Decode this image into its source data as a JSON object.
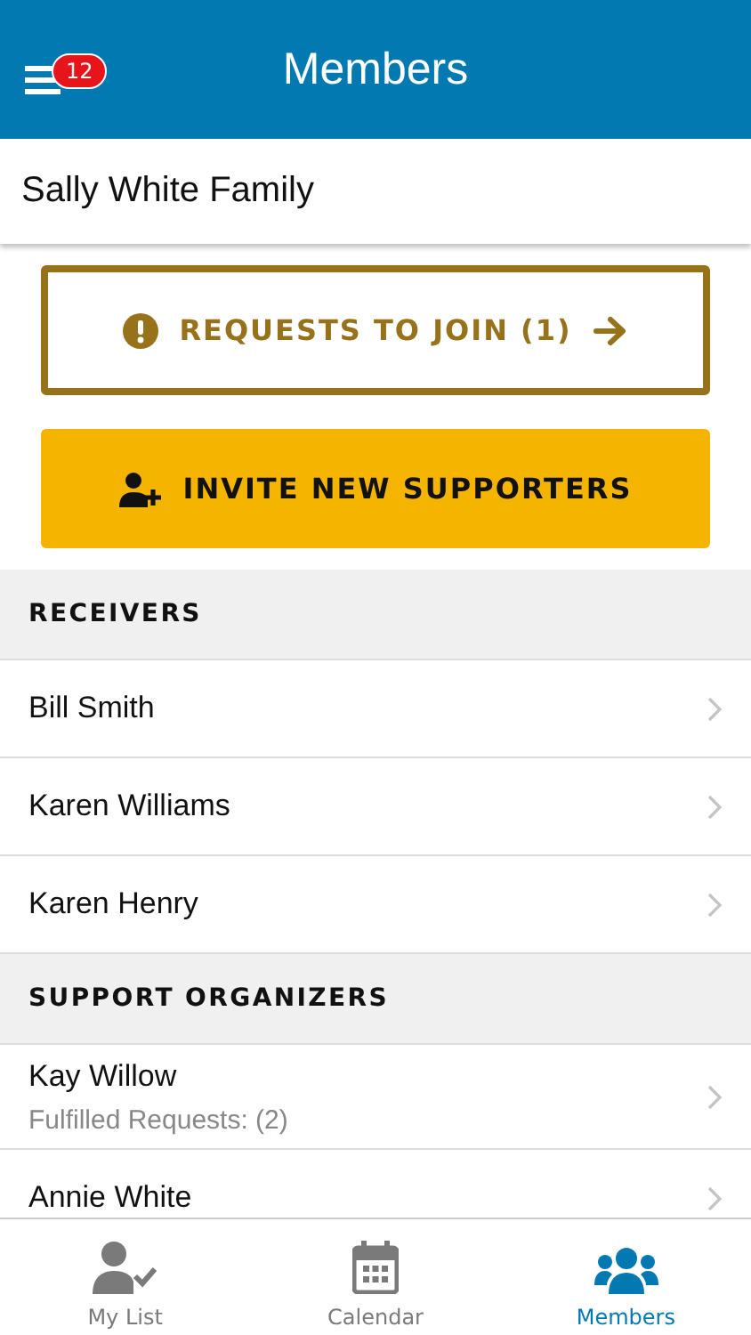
{
  "header": {
    "title": "Members",
    "badge": "12"
  },
  "group": {
    "name": "Sally White Family"
  },
  "requests_button": {
    "label": "REQUESTS TO JOIN (1)"
  },
  "invite_button": {
    "label": "INVITE NEW SUPPORTERS"
  },
  "sections": [
    {
      "title": "RECEIVERS",
      "members": [
        {
          "name": "Bill Smith"
        },
        {
          "name": "Karen Williams"
        },
        {
          "name": "Karen Henry"
        }
      ]
    },
    {
      "title": "SUPPORT ORGANIZERS",
      "members": [
        {
          "name": "Kay Willow",
          "detail": "Fulfilled Requests: (2)"
        },
        {
          "name": "Annie White"
        }
      ]
    }
  ],
  "tabs": [
    {
      "label": "My List",
      "kind": "mylist",
      "selected": false
    },
    {
      "label": "Calendar",
      "kind": "calendar",
      "selected": false
    },
    {
      "label": "Members",
      "kind": "members",
      "selected": true
    }
  ]
}
